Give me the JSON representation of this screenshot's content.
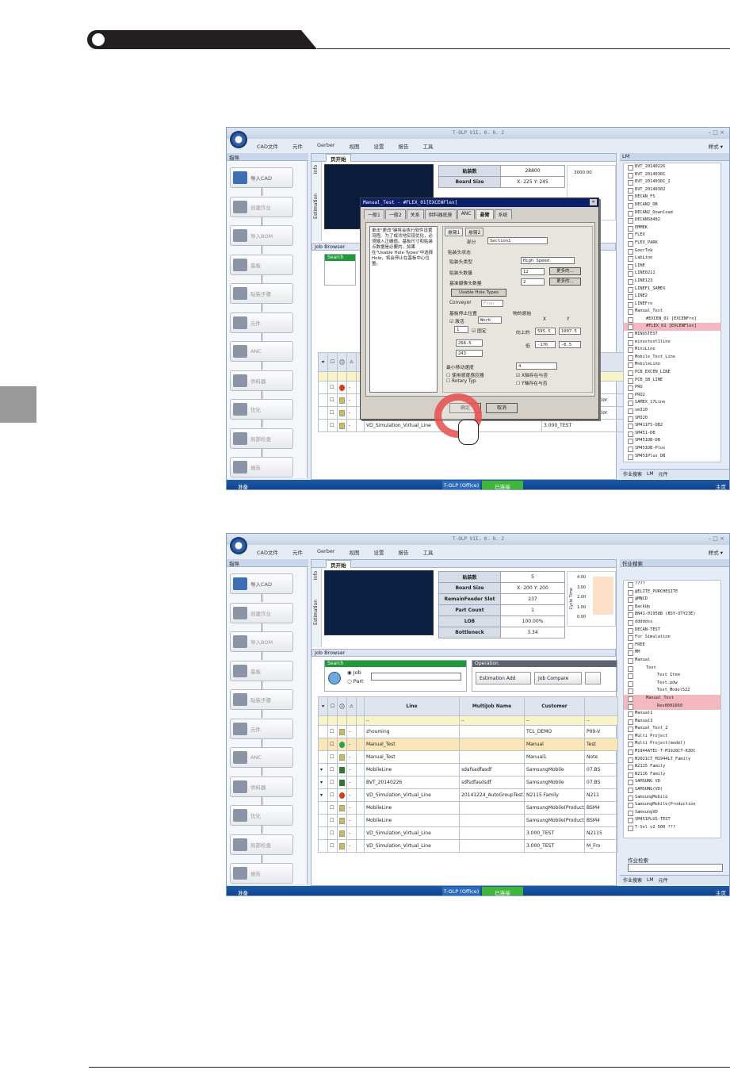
{
  "common": {
    "app_title": "T-OLP V1I. 0. 0. 2",
    "menu": [
      "CAD文件",
      "元件",
      "Gerber",
      "视图",
      "设置",
      "报告",
      "工具"
    ],
    "style_label": "样式 ▾",
    "nav_title": "指导",
    "nav_items": [
      {
        "label": "导入CAD",
        "active": true
      },
      {
        "label": "创建作业",
        "active": false
      },
      {
        "label": "导入BOM",
        "active": false
      },
      {
        "label": "基板",
        "active": false
      },
      {
        "label": "贴装步骤",
        "active": false
      },
      {
        "label": "元件",
        "active": false
      },
      {
        "label": "ANC",
        "active": false
      },
      {
        "label": "供料器",
        "active": false
      },
      {
        "label": "优化",
        "active": false
      },
      {
        "label": "局部检查",
        "active": false
      },
      {
        "label": "报告",
        "active": false
      }
    ],
    "doc_tab": "页开始",
    "side_tabs": [
      "Info",
      "Estimation"
    ],
    "job_browser": "Job Browser",
    "search_label": "Search",
    "radio_job": "Job",
    "radio_part": "Part",
    "operation_label": "Operation",
    "btn_estimation_add": "Estimation Add",
    "btn_job_compare": "Job Compare",
    "columns": [
      "Line",
      "MultiJob Name",
      "Customer"
    ],
    "filter_dash": "--",
    "status_left": "准备",
    "status_mid": "T-OLP (Office)",
    "status_green": "已连接",
    "status_right": "主页",
    "right_tabs": [
      "作业搜索",
      "LM",
      "元件"
    ]
  },
  "shot1": {
    "stats": [
      {
        "k": "贴装数",
        "v": "28800"
      },
      {
        "k": "Board Size",
        "v": "X: 225  Y: 245"
      }
    ],
    "chart_tick": "3000.00",
    "right_title": "LM",
    "tree": [
      "BVT_20140226",
      "BVT_20140301",
      "BVT_20140301_2",
      "BVT_20140302",
      "DECAN_FS",
      "DECAN2_DB",
      "DECAN2_Download",
      "DECANS8482",
      "EMMEK",
      "FLEX",
      "FLEX_PARK",
      "GoerTek",
      "LabLine",
      "LINE",
      "LINE0211",
      "LINE123",
      "LINEF1_SAMEX",
      "LINE2",
      "LINEFro",
      "Manual_Test",
      "#EXCEN_01 [EXCENFro]",
      "#FLEX_01 [EXCENFlex]",
      "MINUSTEST",
      "minustest1line",
      "MiniLine",
      "Mobile_Test_Line",
      "MobileLine",
      "PCB_EXCEN_LINE",
      "PCB_SB_LINE",
      "PRO",
      "PRO2",
      "SAMEX_17Line",
      "sm310",
      "SM320",
      "SM411FS-DB2",
      "SM451-DB",
      "SM451DB-DB",
      "SM451DB-Plus",
      "SM451Plus_DB"
    ],
    "rows": [
      {
        "line": "VD_Simulation_Virtual_Line",
        "multi": "20141224_AutoGroupTest",
        "cust": "N2115 Family",
        "icon": "err"
      },
      {
        "line": "MobileLine",
        "multi": "",
        "cust": "SamsungMobile(Productior",
        "icon": "pdf"
      },
      {
        "line": "MobileLine",
        "multi": "",
        "cust": "SamsungMobile(Productior",
        "icon": "pdf"
      },
      {
        "line": "VD_Simulation_Virtual_Line",
        "multi": "",
        "cust": "3.000_TEST",
        "icon": "pdf"
      }
    ],
    "dialog": {
      "title": "Manual_Test - #FLEX_01[EXCENFlex]",
      "tabs": [
        "一般1",
        "一般2",
        "关系",
        "供料器底座",
        "ANC",
        "悬臂",
        "系统"
      ],
      "sub_tabs": [
        "悬臂1",
        "悬臂2"
      ],
      "help": "单击\"更改\"键将会执行软件设置流程。为了成功地实现优化，必须输入正确值。基板尺寸和贴装点数据是必要的。如果在\"Usable Hole Types\"中选择Hole，将会停止在基板中心位置。",
      "part_label": "部分",
      "part_value": "Section1",
      "head_status": "贴装头状态",
      "head_type": "贴装头类型",
      "head_type_value": "High Speed",
      "head_count": "贴装头数量",
      "head_count_value": "12",
      "cam_count": "基准摄像头数量",
      "cam_count_value": "2",
      "more": "更多的...",
      "hole_btn": "Usable Hole Types",
      "conveyor": "Conveyor",
      "conveyor_value": "Fron",
      "stop_grp": "基板停止位置",
      "stop_enable": "激活",
      "work": "Work",
      "fix": "固定",
      "no_value": "1",
      "x_value": "268.5",
      "y_value": "243",
      "origin_grp": "物的原始",
      "col_x": "X",
      "col_y": "Y",
      "up_label": "向上的",
      "up_x": "595.5",
      "up_y": "1007.5",
      "low_label": "低",
      "low_x": "-176",
      "low_y": "-6.5",
      "min_move": "最小移动速度",
      "min_move_value": "4",
      "sensor": "使用感度感应器",
      "rotary": "Rotary Typ",
      "axis1": "X轴存在与否",
      "axis2": "Y轴存在与否",
      "ok": "确定",
      "cancel": "取消"
    }
  },
  "shot2": {
    "stats": [
      {
        "k": "贴装数",
        "v": "5"
      },
      {
        "k": "Board Size",
        "v": "X: 200  Y: 200"
      },
      {
        "k": "RemainFeeder Slot",
        "v": "237"
      },
      {
        "k": "Part Count",
        "v": "1"
      },
      {
        "k": "LOB",
        "v": "100.00%"
      },
      {
        "k": "Bottleneck",
        "v": "3.34"
      }
    ],
    "chart_ticks": [
      "4.00",
      "3.00",
      "2.00",
      "1.00",
      "0.00"
    ],
    "chart_ylabel": "Cycle Time",
    "right_title": "作业搜索",
    "search_box_label": "作业检索",
    "tree": [
      "????",
      "@ELITE_PURCHESITE",
      "@MNCD",
      "BackUp",
      "BN41-01958B (BSY-OTY23E)",
      "dddddss",
      "DECAN-TEST",
      "For Simulation",
      "FREE",
      "MM",
      "Manual",
      "Test",
      "Test Item",
      "Test.pdw",
      "Test_Model522",
      "Manual_Test",
      "Rev0001660",
      "Manual1",
      "Manual3",
      "Manual_Test_2",
      "Multi Project",
      "Multi Project(model)",
      "M1944ATEC-T-M1928CT-KZOC",
      "M2021CT_M1944LT_Family",
      "N2115 Family",
      "N2116 Family",
      "SAMSUNG VD",
      "SAMSUNG(VD)",
      "SamsungMobile",
      "SamsungMobile(Production",
      "SamsungVD",
      "SM451PLUS-TEST",
      "T-Sol v2 500 ???"
    ],
    "rows": [
      {
        "line": "zhouming",
        "multi": "",
        "cust": "TCL_DEMO",
        "extra": "P09-V",
        "icon": "pdf",
        "expand": false
      },
      {
        "line": "Manual_Test",
        "multi": "",
        "cust": "Manual",
        "extra": "Test",
        "icon": "ok",
        "expand": false,
        "sel": true
      },
      {
        "line": "Manual_Test",
        "multi": "",
        "cust": "Manual1",
        "extra": "Note",
        "icon": "pdf",
        "expand": false
      },
      {
        "line": "MobileLine",
        "multi": "sdafsadfasdf",
        "cust": "SamsungMobile",
        "extra": "07.BS",
        "icon": "grn",
        "expand": true
      },
      {
        "line": "BVT_20140226",
        "multi": "sdfsdfasdsdf",
        "cust": "SamsungMobile",
        "extra": "07.BS",
        "icon": "grn",
        "expand": true
      },
      {
        "line": "VD_Simulation_Virtual_Line",
        "multi": "20141224_AutoGroupTest1",
        "cust": "N2115 Family",
        "extra": "N211",
        "icon": "err",
        "expand": true
      },
      {
        "line": "MobileLine",
        "multi": "",
        "cust": "SamsungMobile(Productior",
        "extra": "BSM4",
        "icon": "pdf",
        "expand": false
      },
      {
        "line": "MobileLine",
        "multi": "",
        "cust": "SamsungMobile(Productior",
        "extra": "BSM4",
        "icon": "pdf",
        "expand": false
      },
      {
        "line": "VD_Simulation_Virtual_Line",
        "multi": "",
        "cust": "3.000_TEST",
        "extra": "N2115",
        "icon": "pdf",
        "expand": false
      },
      {
        "line": "VD_Simulation_Virtual_Line",
        "multi": "",
        "cust": "3.000_TEST",
        "extra": "M_Fro",
        "icon": "pdf",
        "expand": false
      }
    ]
  }
}
